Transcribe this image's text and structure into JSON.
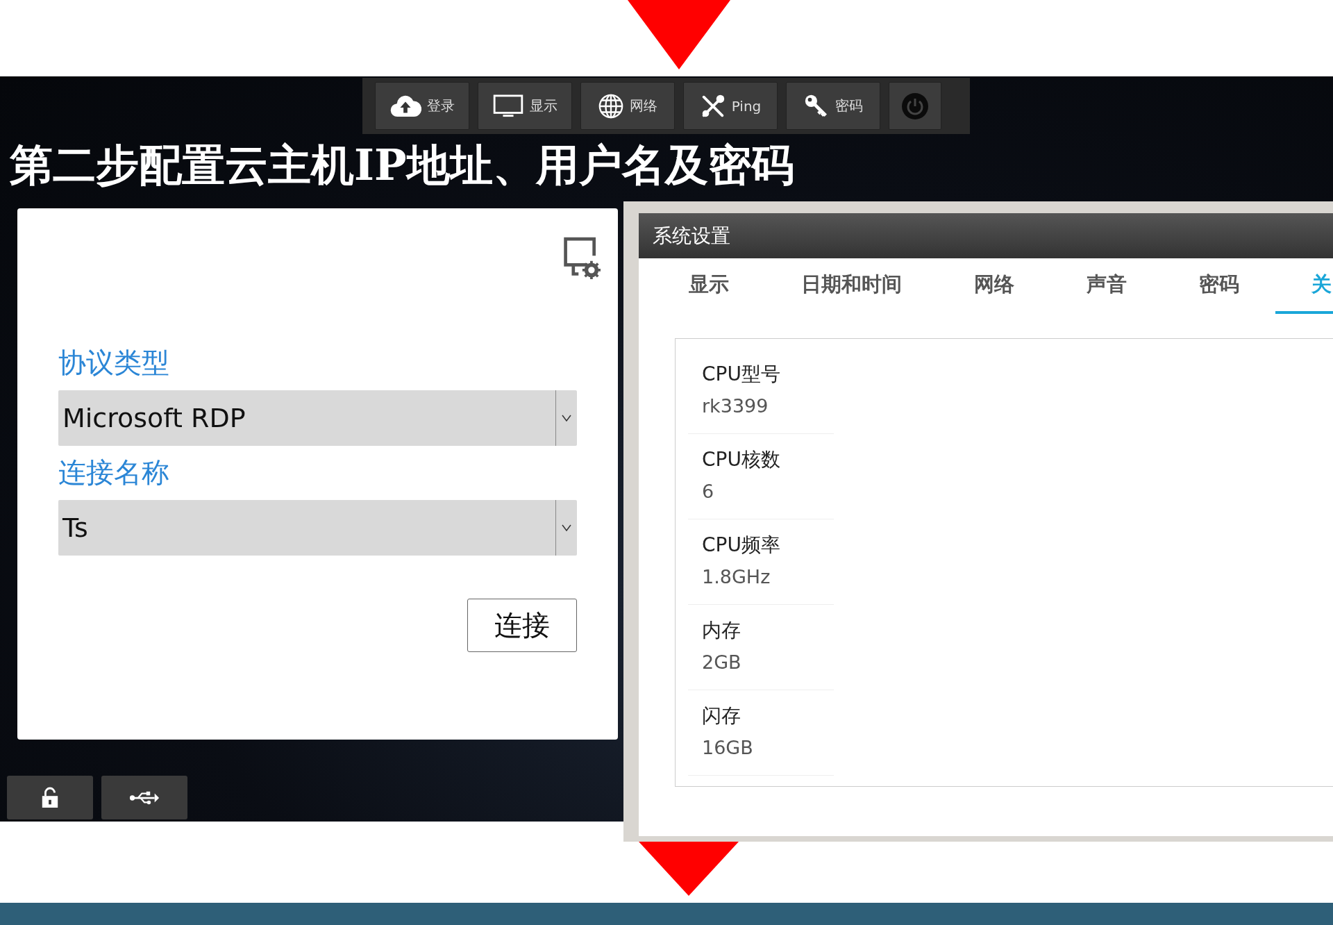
{
  "title": "第二步配置云主机IP地址、用户名及密码",
  "toolbar": [
    {
      "kind": "cloud",
      "label": "登录"
    },
    {
      "kind": "monitor",
      "label": "显示"
    },
    {
      "kind": "globe",
      "label": "网络"
    },
    {
      "kind": "tools",
      "label": "Ping"
    },
    {
      "kind": "key",
      "label": "密码"
    },
    {
      "kind": "power"
    }
  ],
  "login_dialog": {
    "fields": [
      {
        "label": "协议类型",
        "value": "Microsoft RDP"
      },
      {
        "label": "连接名称",
        "value": "Ts"
      }
    ],
    "connect_button": "连接"
  },
  "bottom_buttons": [
    {
      "kind": "lock"
    },
    {
      "kind": "usb"
    }
  ],
  "settings_window": {
    "title": "系统设置",
    "tabs": [
      {
        "label": "显示",
        "selected": false
      },
      {
        "label": "日期和时间",
        "selected": false
      },
      {
        "label": "网络",
        "selected": false
      },
      {
        "label": "声音",
        "selected": false
      },
      {
        "label": "密码",
        "selected": false
      },
      {
        "label": "关",
        "selected": true
      }
    ],
    "info": [
      {
        "name": "CPU型号",
        "value": "rk3399"
      },
      {
        "name": "CPU核数",
        "value": "6"
      },
      {
        "name": "CPU频率",
        "value": "1.8GHz"
      },
      {
        "name": "内存",
        "value": "2GB"
      },
      {
        "name": "闪存",
        "value": "16GB"
      }
    ]
  }
}
